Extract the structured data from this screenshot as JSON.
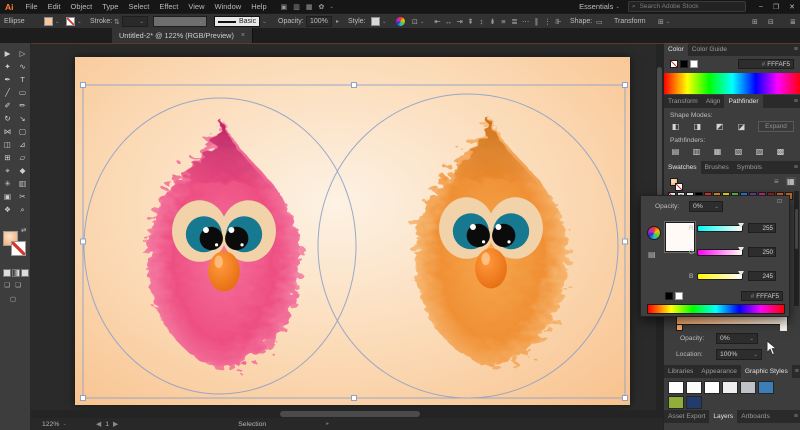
{
  "app": {
    "logo": "Ai",
    "accent": "#ff7f32"
  },
  "menubar": {
    "items": [
      "File",
      "Edit",
      "Object",
      "Type",
      "Select",
      "Effect",
      "View",
      "Window",
      "Help"
    ],
    "right_icons": [
      {
        "name": "bridge-icon",
        "glyph": "▣"
      },
      {
        "name": "stock-icon",
        "glyph": "▥"
      },
      {
        "name": "arrange-documents-icon",
        "glyph": "▦"
      },
      {
        "name": "share-icon",
        "glyph": "✿"
      }
    ],
    "workspace": "Essentials",
    "search_placeholder": "Search Adobe Stock",
    "window_controls": [
      {
        "name": "minimize-button",
        "glyph": "–"
      },
      {
        "name": "restore-button",
        "glyph": "❐"
      },
      {
        "name": "close-button",
        "glyph": "✕"
      }
    ]
  },
  "controlbar": {
    "selection_type": "Ellipse",
    "stroke_label": "Stroke:",
    "brush_name": "Basic",
    "opacity_label": "Opacity:",
    "opacity_value": "100%",
    "style_label": "Style:",
    "shape_label": "Shape:",
    "transform_label": "Transform",
    "align_icons": [
      {
        "name": "align-left-icon",
        "glyph": "⇤"
      },
      {
        "name": "align-center-icon",
        "glyph": "↔"
      },
      {
        "name": "align-right-icon",
        "glyph": "⇥"
      },
      {
        "name": "align-top-icon",
        "glyph": "⇞"
      },
      {
        "name": "align-middle-icon",
        "glyph": "↕"
      },
      {
        "name": "align-bottom-icon",
        "glyph": "⇟"
      },
      {
        "name": "distribute-top-icon",
        "glyph": "≡"
      },
      {
        "name": "distribute-center-icon",
        "glyph": "≣"
      },
      {
        "name": "distribute-bottom-icon",
        "glyph": "⋯"
      },
      {
        "name": "distribute-left-icon",
        "glyph": "∥"
      },
      {
        "name": "distribute-middle-icon",
        "glyph": "⋮"
      },
      {
        "name": "distribute-right-icon",
        "glyph": "⊪"
      }
    ]
  },
  "doc_tab": {
    "title": "Untitled-2* @ 122% (RGB/Preview)",
    "close": "×"
  },
  "tools": [
    {
      "name": "tool-selection",
      "glyph": "▶"
    },
    {
      "name": "tool-direct-selection",
      "glyph": "▷"
    },
    {
      "name": "tool-magic-wand",
      "glyph": "✦"
    },
    {
      "name": "tool-lasso",
      "glyph": "∿"
    },
    {
      "name": "tool-pen",
      "glyph": "✒"
    },
    {
      "name": "tool-type",
      "glyph": "T"
    },
    {
      "name": "tool-line-segment",
      "glyph": "╱"
    },
    {
      "name": "tool-rectangle",
      "glyph": "▭"
    },
    {
      "name": "tool-paintbrush",
      "glyph": "✐"
    },
    {
      "name": "tool-pencil",
      "glyph": "✏"
    },
    {
      "name": "tool-rotate",
      "glyph": "↻"
    },
    {
      "name": "tool-scale",
      "glyph": "↘"
    },
    {
      "name": "tool-width",
      "glyph": "⋈"
    },
    {
      "name": "tool-free-transform",
      "glyph": "▢"
    },
    {
      "name": "tool-shape-builder",
      "glyph": "◫"
    },
    {
      "name": "tool-perspective-grid",
      "glyph": "⊿"
    },
    {
      "name": "tool-mesh",
      "glyph": "⊞"
    },
    {
      "name": "tool-gradient",
      "glyph": "▱"
    },
    {
      "name": "tool-eyedropper",
      "glyph": "⌖"
    },
    {
      "name": "tool-blend",
      "glyph": "◆"
    },
    {
      "name": "tool-symbol-sprayer",
      "glyph": "✳"
    },
    {
      "name": "tool-column-graph",
      "glyph": "▥"
    },
    {
      "name": "tool-artboard",
      "glyph": "▣"
    },
    {
      "name": "tool-slice",
      "glyph": "✂"
    },
    {
      "name": "tool-hand",
      "glyph": "❖"
    },
    {
      "name": "tool-zoom",
      "glyph": "⌕"
    }
  ],
  "panels": {
    "color_panel": {
      "tabs": [
        "Color",
        "Color Guide"
      ],
      "active_tab": "Color",
      "hex": "FFFAF5"
    },
    "pathfinder_panel": {
      "tabs": [
        "Transform",
        "Align",
        "Pathfinder"
      ],
      "active_tab": "Pathfinder",
      "shape_modes_label": "Shape Modes:",
      "pathfinders_label": "Pathfinders:",
      "expand_label": "Expand",
      "shape_mode_icons": [
        {
          "name": "unite-icon",
          "glyph": "◧"
        },
        {
          "name": "minus-front-icon",
          "glyph": "◨"
        },
        {
          "name": "intersect-icon",
          "glyph": "◩"
        },
        {
          "name": "exclude-icon",
          "glyph": "◪"
        }
      ],
      "pathfinder_icons": [
        {
          "name": "divide-icon",
          "glyph": "▤"
        },
        {
          "name": "trim-icon",
          "glyph": "▥"
        },
        {
          "name": "merge-icon",
          "glyph": "▦"
        },
        {
          "name": "crop-icon",
          "glyph": "▧"
        },
        {
          "name": "outline-icon",
          "glyph": "▨"
        },
        {
          "name": "minus-back-icon",
          "glyph": "▩"
        }
      ]
    },
    "swatches_panel": {
      "tabs": [
        "Swatches",
        "Brushes",
        "Symbols"
      ],
      "active_tab": "Swatches",
      "swatches": [
        "none",
        "reg",
        "#ffffff",
        "#000000",
        "#e8362b",
        "#ef8d1f",
        "#f7df0e",
        "#69bd45",
        "#2e7cd6",
        "#6f3f97",
        "#c42a84",
        "#9e1c20",
        "#e05a24",
        "#c06a1e"
      ]
    },
    "color_popup": {
      "opacity_label": "Opacity:",
      "opacity_value": "0%",
      "hex": "FFFAF5",
      "sliders": [
        {
          "label": "R",
          "value": "255",
          "from": "#00faf5",
          "to": "#fffaf5"
        },
        {
          "label": "G",
          "value": "250",
          "from": "#ff00f5",
          "to": "#fffff5"
        },
        {
          "label": "B",
          "value": "245",
          "from": "#fffa00",
          "to": "#fffaff"
        }
      ]
    },
    "gradient_panel": {
      "opacity_label": "Opacity:",
      "opacity_value": "0%",
      "location_label": "Location:",
      "location_value": "100%",
      "start_color": "#f8a968",
      "end_color": "#fdf4ea"
    },
    "styles_panel": {
      "tabs": [
        "Libraries",
        "Appearance",
        "Graphic Styles"
      ],
      "active_tab": "Graphic Styles",
      "thumbs": [
        "#ffffff",
        "#fbfbfb",
        "#ffffff",
        "#efefef",
        "#bfc3c7",
        "#3c7eb8",
        "#8fae3a",
        "#223b6d"
      ]
    },
    "bottom_tabs": {
      "tabs": [
        "Asset Export",
        "Layers",
        "Artboards"
      ],
      "active_tab": "Layers"
    }
  },
  "statusbar": {
    "zoom": "122%",
    "nav_value": "1",
    "status_label": "Selection"
  },
  "canvas": {
    "artboard_center": "#fdf2e4",
    "artboard_mid": "#fbd9b4",
    "artboard_edge": "#f8c18c",
    "guide_color": "#8fa2c8",
    "eye_patch": "#f1d2a9",
    "iris": "#17798f",
    "iris_ring": "#0d5a6c",
    "pupil": "#0b0b0b",
    "glint": "#ffffff",
    "beak_light": "#ff9a3d",
    "beak_dark": "#e2660a",
    "birds": [
      {
        "name": "pink-bird",
        "fur_light": "#f5739f",
        "fur_base": "#ee4f82",
        "fur_edge": "#f89ab8",
        "tip_dark": "#b81b5c"
      },
      {
        "name": "orange-bird",
        "fur_light": "#f6a94f",
        "fur_base": "#f09035",
        "fur_edge": "#fbd39c",
        "tip_dark": "#c96a10"
      }
    ]
  }
}
